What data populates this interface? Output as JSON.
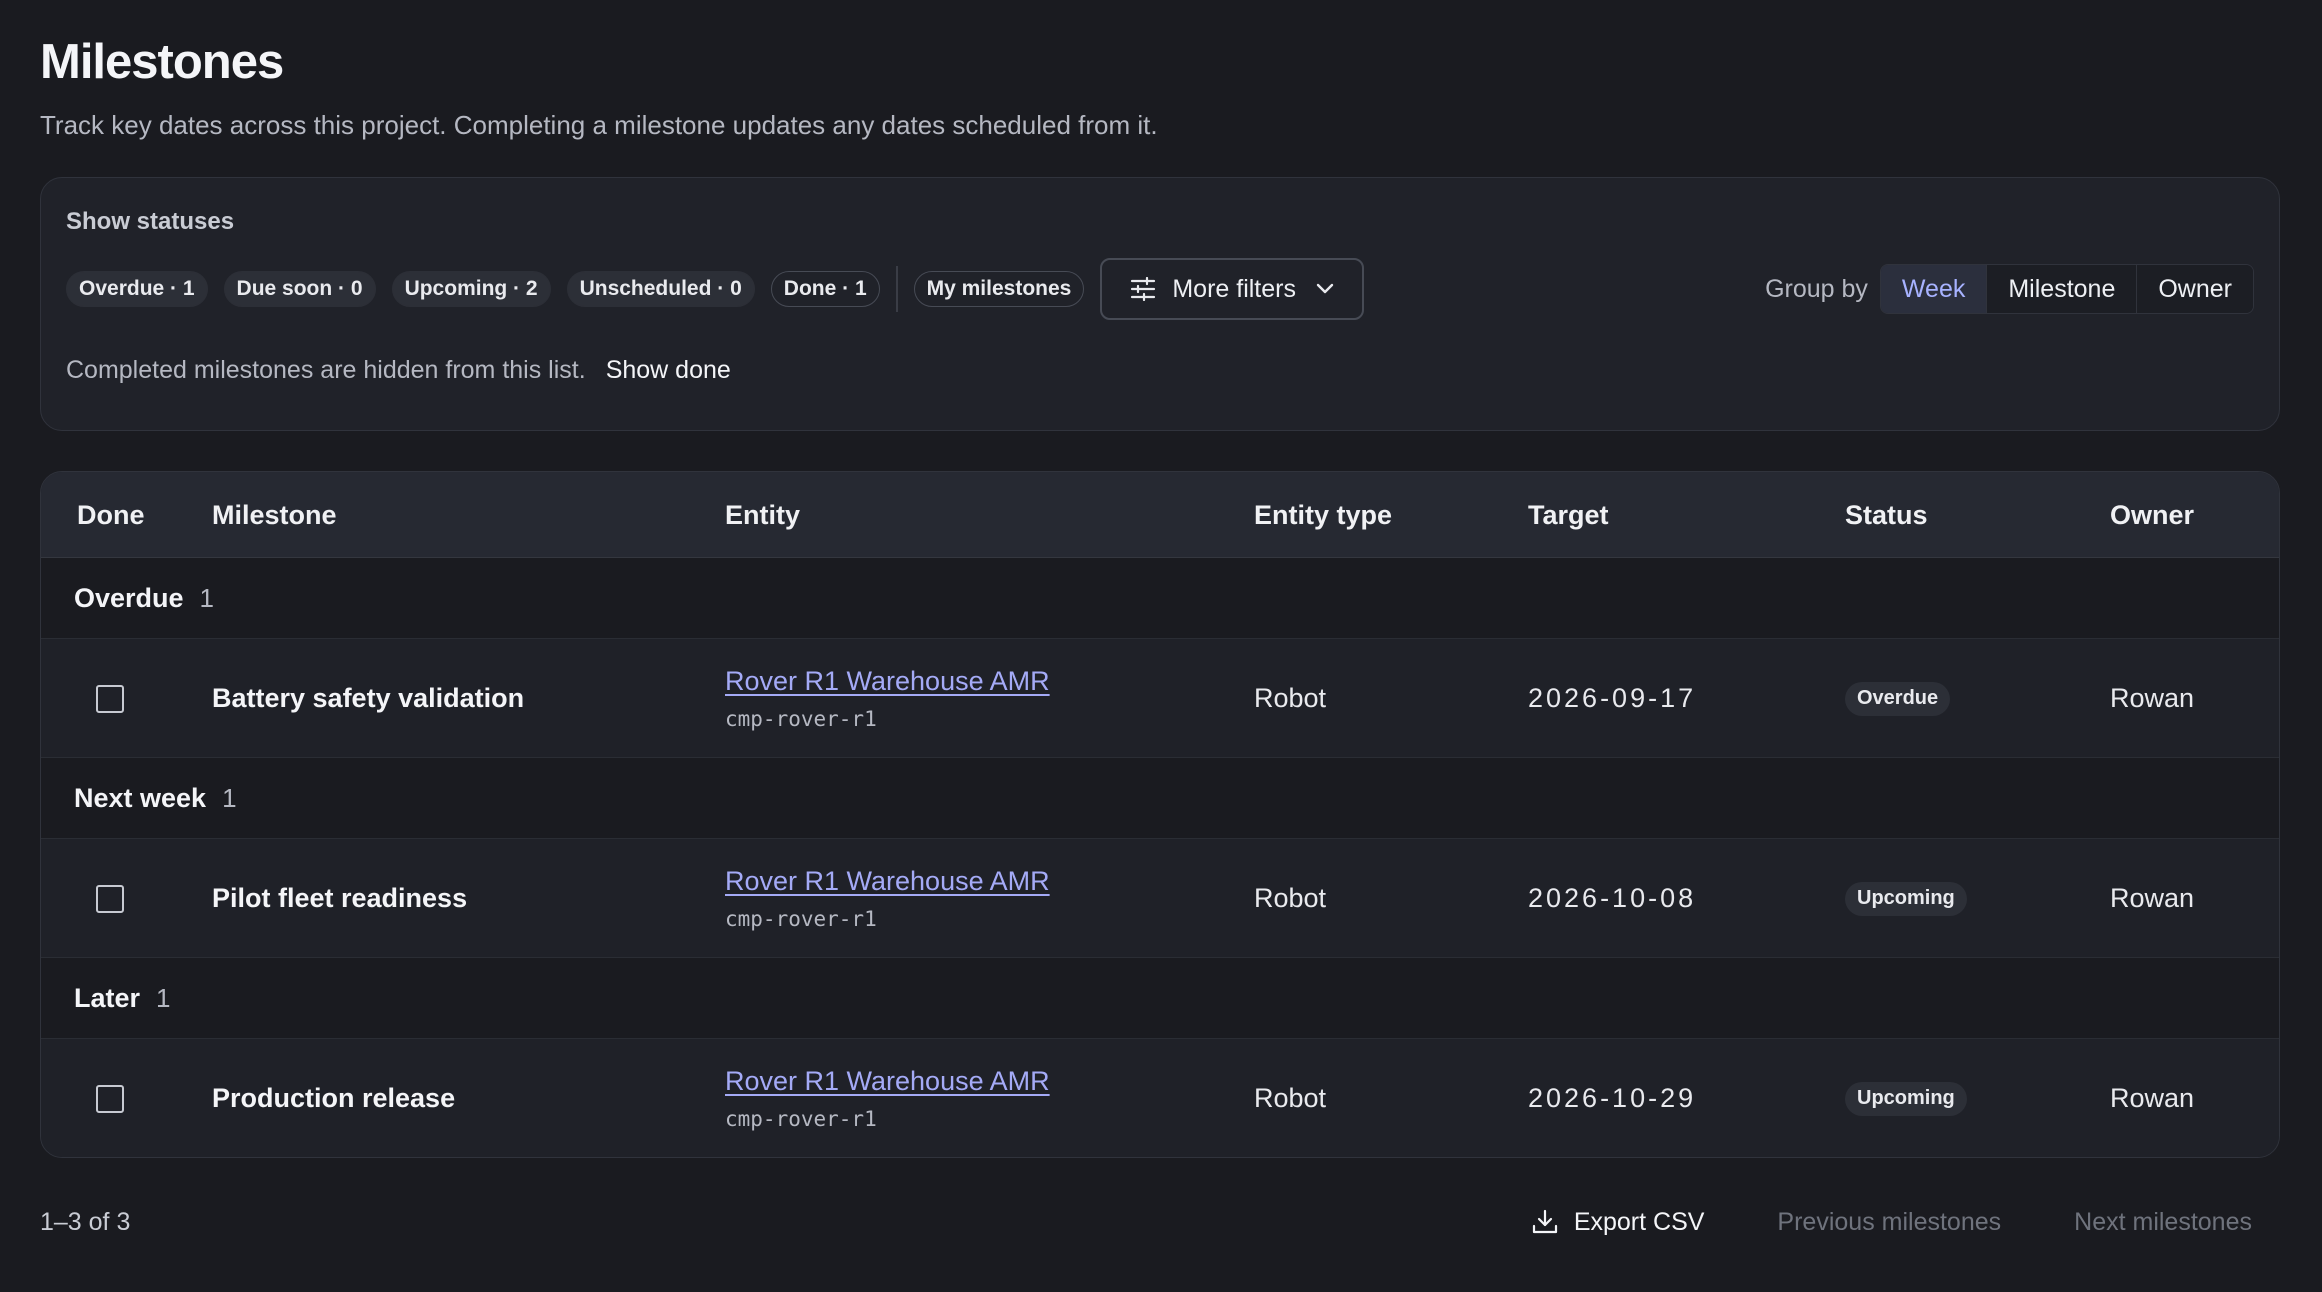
{
  "page": {
    "title": "Milestones",
    "subtitle": "Track key dates across this project. Completing a milestone updates any dates scheduled from it."
  },
  "filters": {
    "label": "Show statuses",
    "chips": [
      "Overdue · 1",
      "Due soon · 0",
      "Upcoming · 2",
      "Unscheduled · 0",
      "Done · 1"
    ],
    "my_milestones": "My milestones",
    "more_filters": "More filters",
    "group_by_label": "Group by",
    "group_by_options": [
      "Week",
      "Milestone",
      "Owner"
    ],
    "group_by_selected": "Week",
    "hint": "Completed milestones are hidden from this list.",
    "show_done": "Show done"
  },
  "table": {
    "columns": [
      "Done",
      "Milestone",
      "Entity",
      "Entity type",
      "Target",
      "Status",
      "Owner"
    ],
    "groups": [
      {
        "name": "Overdue",
        "count": "1",
        "rows": [
          {
            "done": false,
            "milestone": "Battery safety validation",
            "entity": "Rover R1 Warehouse AMR",
            "entity_code": "cmp-rover-r1",
            "entity_type": "Robot",
            "target": "2026-09-17",
            "status": "Overdue",
            "owner": "Rowan"
          }
        ]
      },
      {
        "name": "Next week",
        "count": "1",
        "rows": [
          {
            "done": false,
            "milestone": "Pilot fleet readiness",
            "entity": "Rover R1 Warehouse AMR",
            "entity_code": "cmp-rover-r1",
            "entity_type": "Robot",
            "target": "2026-10-08",
            "status": "Upcoming",
            "owner": "Rowan"
          }
        ]
      },
      {
        "name": "Later",
        "count": "1",
        "rows": [
          {
            "done": false,
            "milestone": "Production release",
            "entity": "Rover R1 Warehouse AMR",
            "entity_code": "cmp-rover-r1",
            "entity_type": "Robot",
            "target": "2026-10-29",
            "status": "Upcoming",
            "owner": "Rowan"
          }
        ]
      }
    ]
  },
  "footer": {
    "range": "1–3 of 3",
    "export": "Export CSV",
    "previous": "Previous milestones",
    "next": "Next milestones"
  },
  "colors": {
    "background": "#1a1b20",
    "accent": "#a7b2ff",
    "link": "#a4aaf6"
  },
  "icons": {
    "more_filters": "sliders-icon",
    "more_filters_caret": "chevron-down-icon",
    "export": "download-icon"
  }
}
